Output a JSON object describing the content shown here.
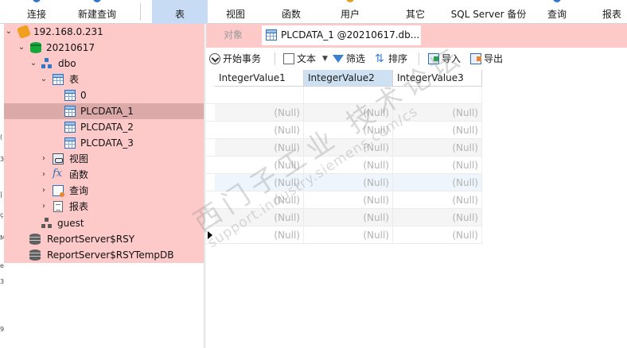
{
  "toolbar": {
    "items": [
      {
        "label": "连接",
        "icon": "connect-icon"
      },
      {
        "label": "新建查询",
        "icon": "new-query-icon"
      },
      {
        "label": "表",
        "icon": "table-icon",
        "active": true
      },
      {
        "label": "视图",
        "icon": "view-icon"
      },
      {
        "label": "函数",
        "icon": "function-icon"
      },
      {
        "label": "用户",
        "icon": "user-icon"
      },
      {
        "label": "其它",
        "icon": "other-icon"
      },
      {
        "label": "SQL Server 备份",
        "icon": "backup-icon"
      },
      {
        "label": "查询",
        "icon": "query-icon"
      },
      {
        "label": "报表",
        "icon": "report-icon"
      }
    ]
  },
  "tree": {
    "connection": "192.168.0.231",
    "database": "20210617",
    "schema": "dbo",
    "tables_folder": "表",
    "tables": [
      "0",
      "PLCDATA_1",
      "PLCDATA_2",
      "PLCDATA_3"
    ],
    "selected_table": "PLCDATA_1",
    "views_folder": "视图",
    "functions_folder": "函数",
    "queries_folder": "查询",
    "reports_folder": "报表",
    "guest": "guest",
    "other_dbs": [
      "ReportServer$RSY",
      "ReportServer$RSYTempDB"
    ]
  },
  "tabs": {
    "objects": "对象",
    "active": "PLCDATA_1 @20210617.db..."
  },
  "table_toolbar": {
    "begin_transaction": "开始事务",
    "text": "文本",
    "filter": "筛选",
    "sort": "排序",
    "import": "导入",
    "export": "导出"
  },
  "grid": {
    "columns": [
      "IntegerValue1",
      "IntegerValue2",
      "IntegerValue3"
    ],
    "selected_column": "IntegerValue2",
    "null_text": "(Null)",
    "row_count": 8,
    "blank_first_row": true
  },
  "watermark": {
    "line1": "西门子工业 技术论坛",
    "line2": "support.industry.siemens.com/cs"
  },
  "colors": {
    "connection_highlight": "#fdc9c9",
    "selected_row": "#dca9a9",
    "active_toolbar": "#c7dcf4",
    "selected_column_header": "#cde1f3",
    "null_text": "#b3b3b3"
  }
}
